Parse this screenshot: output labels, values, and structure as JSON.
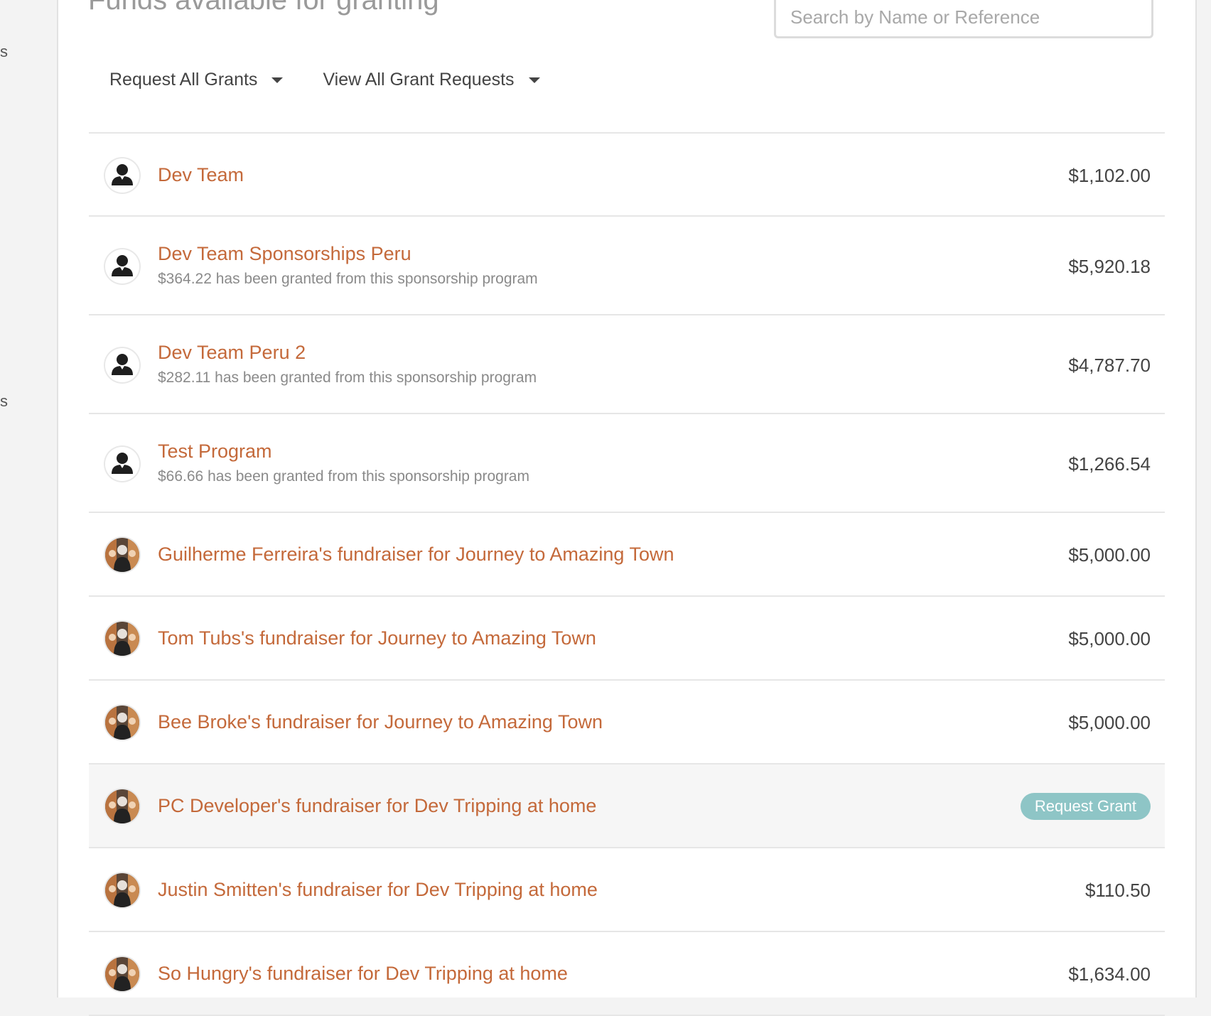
{
  "left_fragments": [
    "s",
    "s"
  ],
  "header": {
    "title": "Funds available for granting",
    "search_placeholder": "Search by Name or Reference"
  },
  "toolbar": {
    "request_all": "Request All Grants",
    "view_all": "View All Grant Requests"
  },
  "colors": {
    "link": "#c4693a",
    "button": "#8ec5c6",
    "highlight_row": "#f6f6f6"
  },
  "rows": [
    {
      "avatar": "person-icon",
      "title": "Dev Team",
      "subtitle": "",
      "amount": "$1,102.00"
    },
    {
      "avatar": "person-icon",
      "title": "Dev Team Sponsorships Peru",
      "subtitle": "$364.22 has been granted from this sponsorship program",
      "amount": "$5,920.18"
    },
    {
      "avatar": "person-icon",
      "title": "Dev Team Peru 2",
      "subtitle": "$282.11 has been granted from this sponsorship program",
      "amount": "$4,787.70"
    },
    {
      "avatar": "person-icon",
      "title": "Test Program",
      "subtitle": "$66.66 has been granted from this sponsorship program",
      "amount": "$1,266.54"
    },
    {
      "avatar": "photo-avatar",
      "title": "Guilherme Ferreira's fundraiser for Journey to Amazing Town",
      "subtitle": "",
      "amount": "$5,000.00"
    },
    {
      "avatar": "photo-avatar",
      "title": "Tom Tubs's fundraiser for Journey to Amazing Town",
      "subtitle": "",
      "amount": "$5,000.00"
    },
    {
      "avatar": "photo-avatar",
      "title": "Bee Broke's fundraiser for Journey to Amazing Town",
      "subtitle": "",
      "amount": "$5,000.00"
    },
    {
      "avatar": "photo-avatar",
      "title": "PC Developer's fundraiser for Dev Tripping at home",
      "subtitle": "",
      "amount": "",
      "button": "Request Grant"
    },
    {
      "avatar": "photo-avatar",
      "title": "Justin Smitten's fundraiser for Dev Tripping at home",
      "subtitle": "",
      "amount": "$110.50"
    },
    {
      "avatar": "photo-avatar",
      "title": "So Hungry's fundraiser for Dev Tripping at home",
      "subtitle": "",
      "amount": "$1,634.00"
    }
  ]
}
